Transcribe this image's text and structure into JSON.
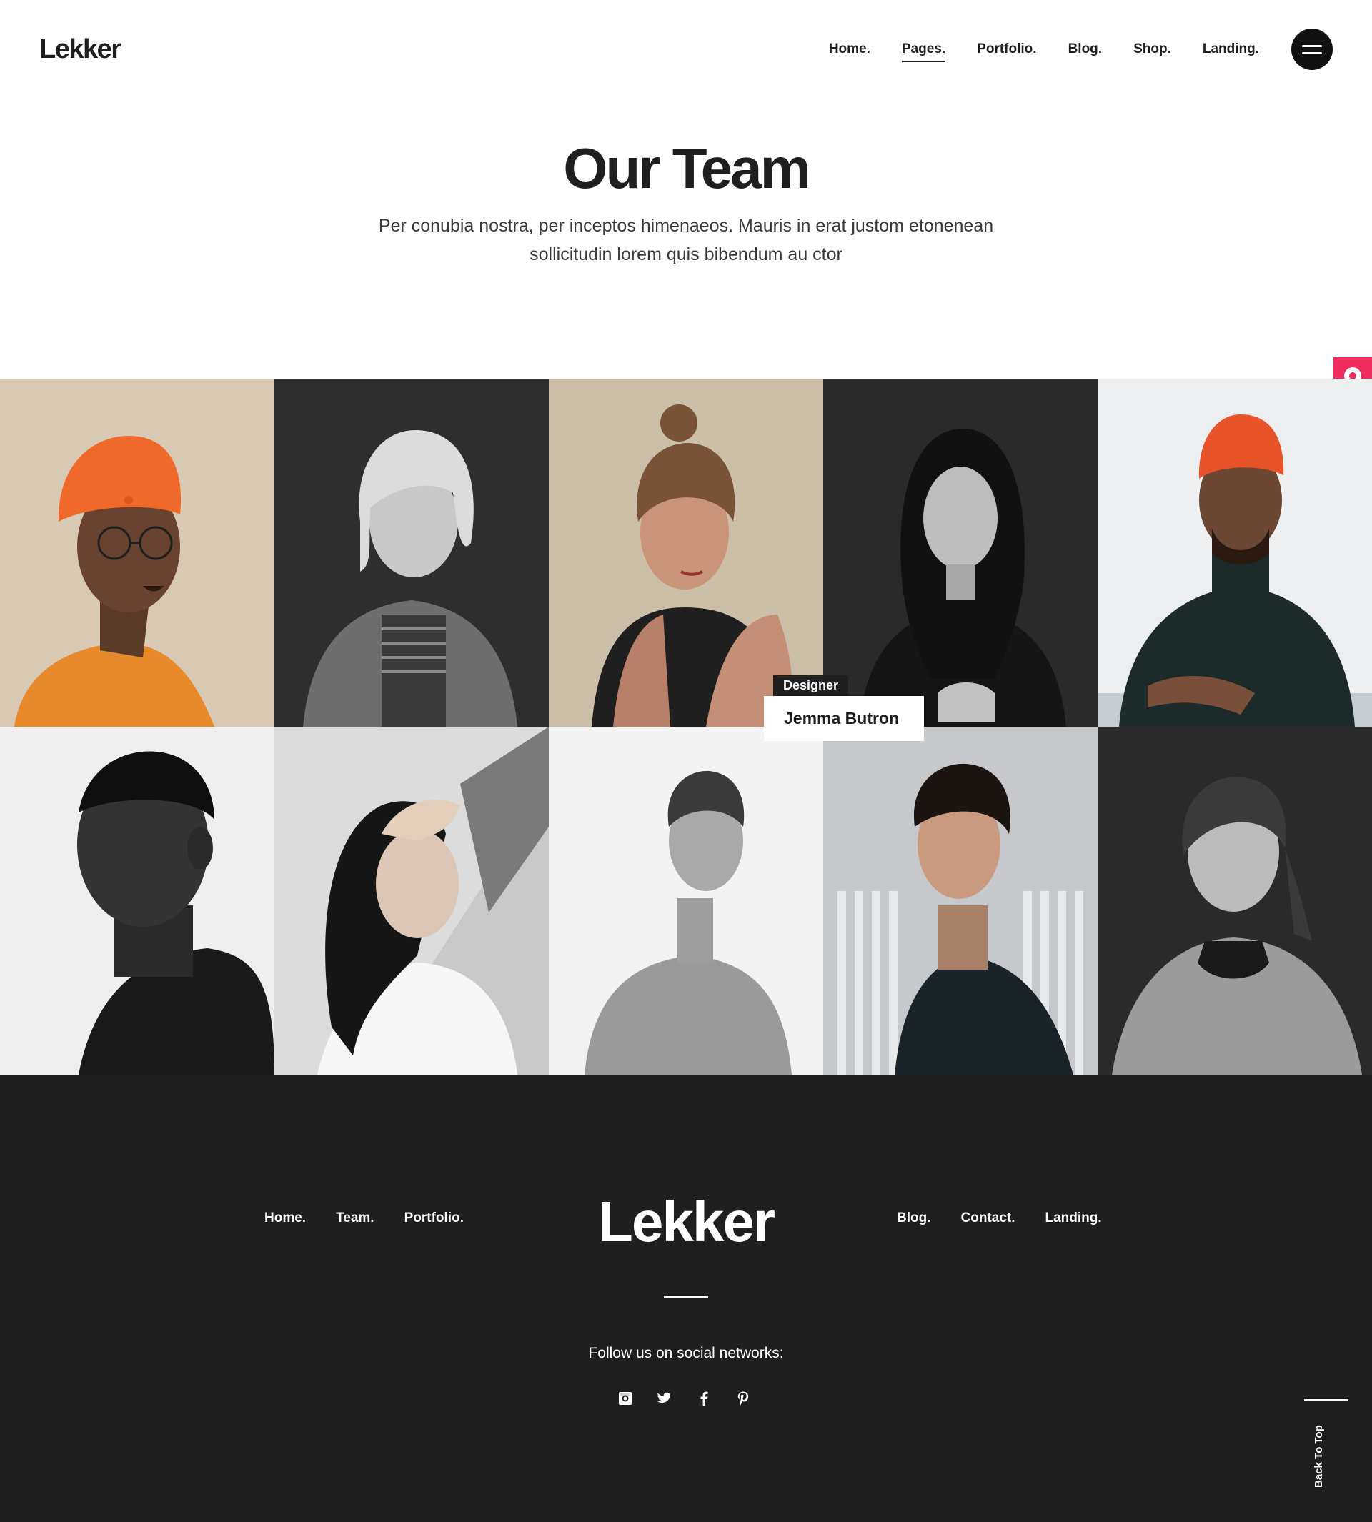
{
  "brand": {
    "name": "Lekker",
    "accent": "#ef2d5e"
  },
  "nav": {
    "items": [
      {
        "label": "Home.",
        "active": false
      },
      {
        "label": "Pages.",
        "active": true
      },
      {
        "label": "Portfolio.",
        "active": false
      },
      {
        "label": "Blog.",
        "active": false
      },
      {
        "label": "Shop.",
        "active": false
      },
      {
        "label": "Landing.",
        "active": false
      }
    ],
    "menu_icon": "hamburger-icon"
  },
  "hero": {
    "title": "Our Team",
    "subtitle_line1": "Per conubia nostra, per inceptos himenaeos. Mauris in erat justom etonenean",
    "subtitle_line2": "sollicitudin lorem quis bibendum au ctor"
  },
  "side_widgets": [
    {
      "icon": "chat-bubble-icon"
    },
    {
      "icon": "cart-icon"
    }
  ],
  "team": {
    "hover_label": {
      "role": "Designer",
      "name": "Jemma Butron"
    },
    "tiles": [
      {
        "bg": "#d8c9b4",
        "style": "orange-beanie-glasses"
      },
      {
        "bg": "#2e2e2e",
        "style": "blonde-denim-jacket"
      },
      {
        "bg": "#cbbfa9",
        "style": "bun-hair-tattoo"
      },
      {
        "bg": "#2a2a2a",
        "style": "dark-hair-woman"
      },
      {
        "bg": "#eceef0",
        "style": "orange-beanie-turtleneck"
      },
      {
        "bg": "#efefef",
        "style": "bw-man-profile"
      },
      {
        "bg": "#c9c9c9",
        "style": "woman-hand-in-hair"
      },
      {
        "bg": "#f3f3f3",
        "style": "young-man-tshirt"
      },
      {
        "bg": "#c6c8cb",
        "style": "man-dark-jacket"
      },
      {
        "bg": "#2a2a2a",
        "style": "woman-grey-hoodie"
      }
    ]
  },
  "footer": {
    "nav_left": [
      "Home.",
      "Team.",
      "Portfolio."
    ],
    "nav_right": [
      "Blog.",
      "Contact.",
      "Landing."
    ],
    "logo": "Lekker",
    "follow_text": "Follow us on social networks:",
    "social": [
      "instagram-icon",
      "twitter-icon",
      "facebook-icon",
      "pinterest-icon"
    ],
    "back_to_top": "Back To Top"
  }
}
